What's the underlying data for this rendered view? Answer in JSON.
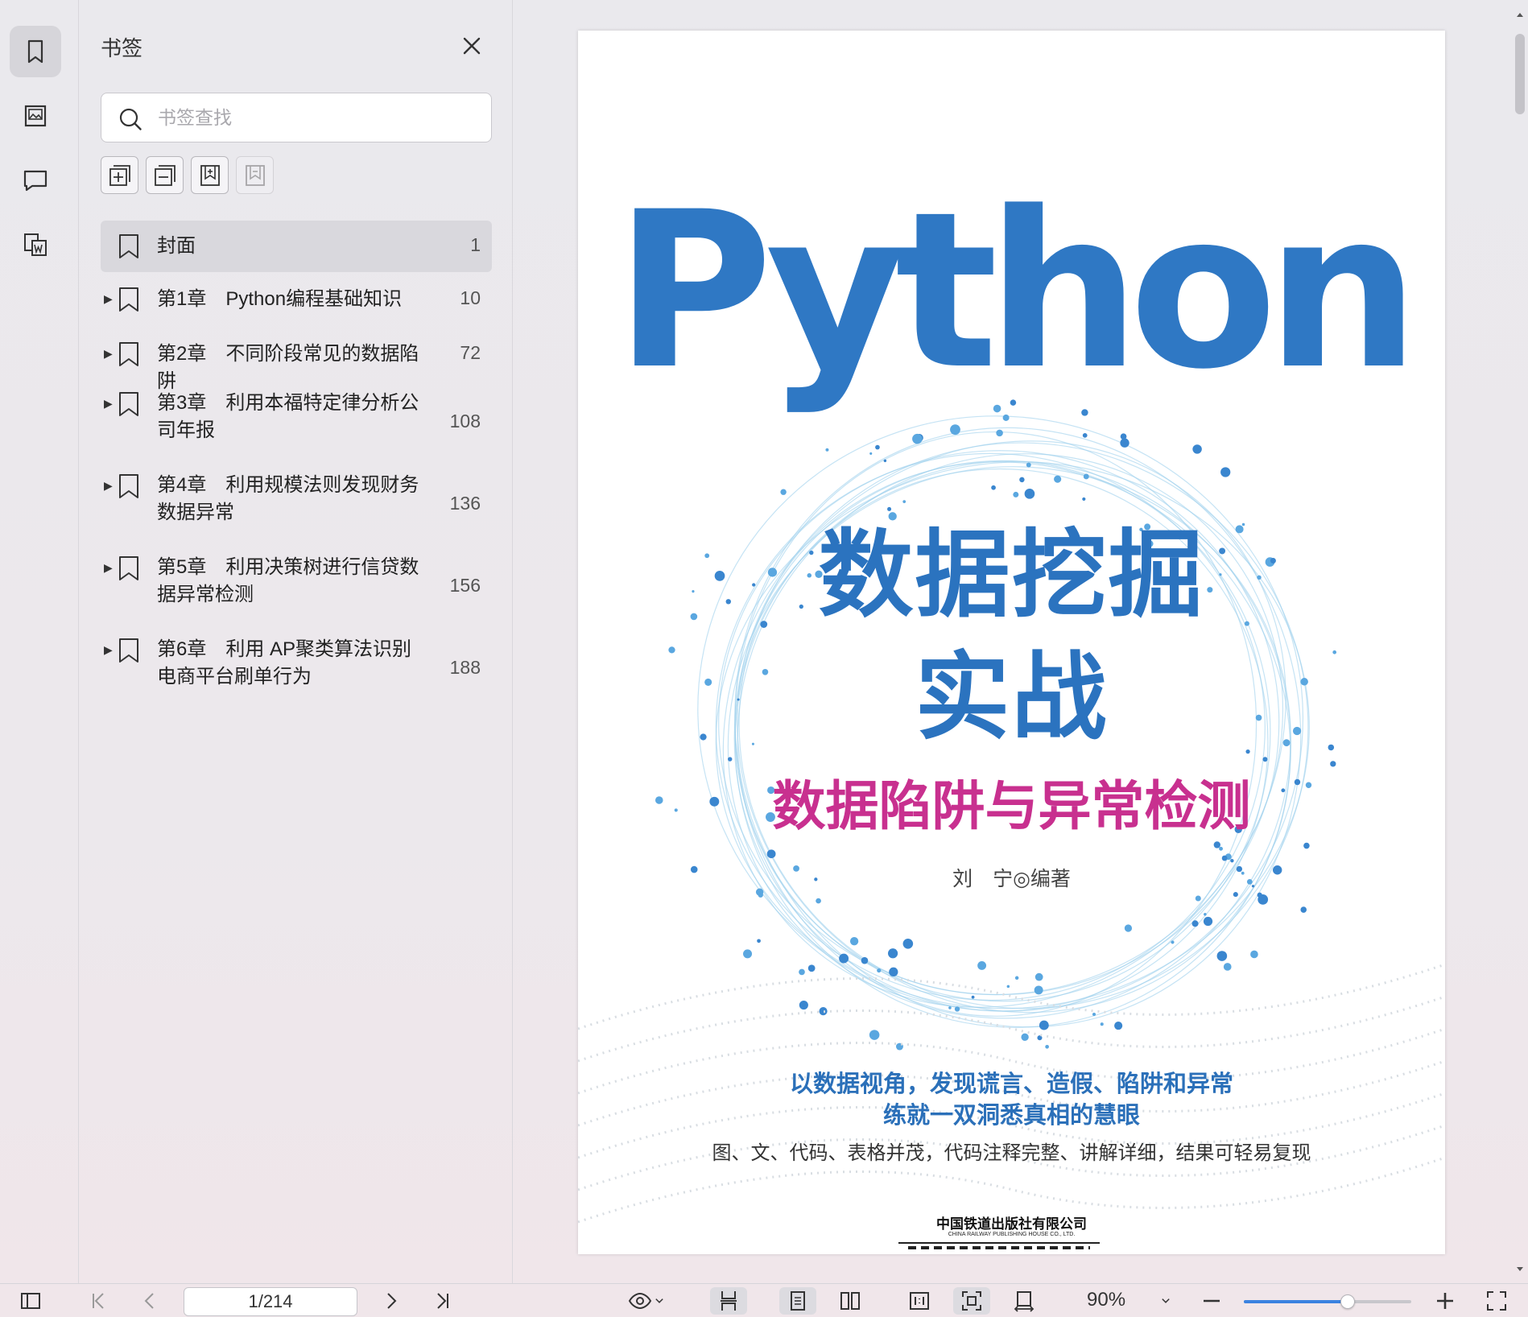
{
  "panel": {
    "title": "书签",
    "search_placeholder": "书签查找"
  },
  "bookmarks": [
    {
      "label": "封面",
      "page": "1",
      "expandable": false,
      "selected": true
    },
    {
      "label": "第1章　Python编程基础知识",
      "page": "10",
      "expandable": true
    },
    {
      "label": "第2章　不同阶段常见的数据陷阱",
      "page": "72",
      "expandable": true
    },
    {
      "label": "第3章　利用本福特定律分析公司年报",
      "page": "108",
      "expandable": true
    },
    {
      "label": "第4章　利用规模法则发现财务数据异常",
      "page": "136",
      "expandable": true
    },
    {
      "label": "第5章　利用决策树进行信贷数据异常检测",
      "page": "156",
      "expandable": true
    },
    {
      "label": "第6章　利用 AP聚类算法识别电商平台刷单行为",
      "page": "188",
      "expandable": true
    }
  ],
  "cover": {
    "title_en": "Python",
    "title_line1": "数据挖掘",
    "title_line2": "实战",
    "subtitle": "数据陷阱与异常检测",
    "author": "刘　宁◎编著",
    "slogan1": "以数据视角，发现谎言、造假、陷阱和异常",
    "slogan2": "练就一双洞悉真相的慧眼",
    "slogan3": "图、文、代码、表格并茂，代码注释完整、讲解详细，结果可轻易复现",
    "publisher": "中国铁道出版社有限公司",
    "publisher_en": "CHINA RAILWAY PUBLISHING HOUSE CO., LTD."
  },
  "navigation": {
    "page_indicator": "1/214",
    "zoom": "90%",
    "zoom_fraction": 0.62
  },
  "colors": {
    "python_blue": "#2f78c4",
    "subtitle_magenta": "#c8308f",
    "accent": "#3b82e0"
  }
}
